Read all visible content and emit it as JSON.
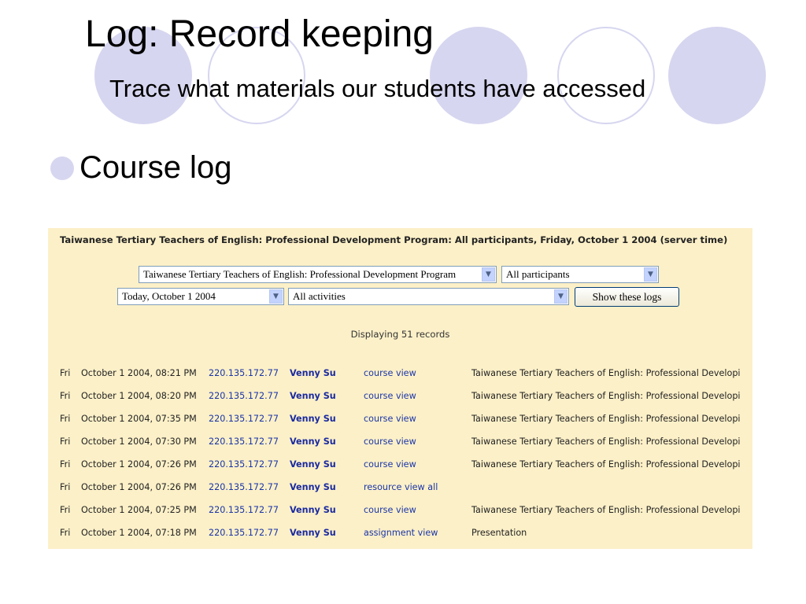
{
  "slide": {
    "title": "Log: Record keeping",
    "subtitle": "Trace what materials our students have accessed",
    "bullet": "Course log"
  },
  "theme": {
    "circle_color": "#d6d6f0",
    "panel_bg": "#fcf0c8",
    "link_color": "#1a35a8"
  },
  "log_page": {
    "header": "Taiwanese Tertiary Teachers of English: Professional Development Program: All participants, Friday, October 1 2004 (server time)",
    "filters": {
      "course_select": "Taiwanese Tertiary Teachers of English: Professional Development Program",
      "participants_select": "All participants",
      "date_select": "Today, October 1 2004",
      "activities_select": "All activities",
      "show_button": "Show these logs"
    },
    "records_label": "Displaying 51 records",
    "rows": [
      {
        "day": "Fri",
        "datetime": "October 1 2004, 08:21 PM",
        "ip": "220.135.172.77",
        "user": "Venny Su",
        "action": "course view",
        "info": "Taiwanese Tertiary Teachers of English: Professional Developi"
      },
      {
        "day": "Fri",
        "datetime": "October 1 2004, 08:20 PM",
        "ip": "220.135.172.77",
        "user": "Venny Su",
        "action": "course view",
        "info": "Taiwanese Tertiary Teachers of English: Professional Developi"
      },
      {
        "day": "Fri",
        "datetime": "October 1 2004, 07:35 PM",
        "ip": "220.135.172.77",
        "user": "Venny Su",
        "action": "course view",
        "info": "Taiwanese Tertiary Teachers of English: Professional Developi"
      },
      {
        "day": "Fri",
        "datetime": "October 1 2004, 07:30 PM",
        "ip": "220.135.172.77",
        "user": "Venny Su",
        "action": "course view",
        "info": "Taiwanese Tertiary Teachers of English: Professional Developi"
      },
      {
        "day": "Fri",
        "datetime": "October 1 2004, 07:26 PM",
        "ip": "220.135.172.77",
        "user": "Venny Su",
        "action": "course view",
        "info": "Taiwanese Tertiary Teachers of English: Professional Developi"
      },
      {
        "day": "Fri",
        "datetime": "October 1 2004, 07:26 PM",
        "ip": "220.135.172.77",
        "user": "Venny Su",
        "action": "resource view all",
        "info": ""
      },
      {
        "day": "Fri",
        "datetime": "October 1 2004, 07:25 PM",
        "ip": "220.135.172.77",
        "user": "Venny Su",
        "action": "course view",
        "info": "Taiwanese Tertiary Teachers of English: Professional Developi"
      },
      {
        "day": "Fri",
        "datetime": "October 1 2004, 07:18 PM",
        "ip": "220.135.172.77",
        "user": "Venny Su",
        "action": "assignment view",
        "info": "Presentation"
      }
    ]
  }
}
